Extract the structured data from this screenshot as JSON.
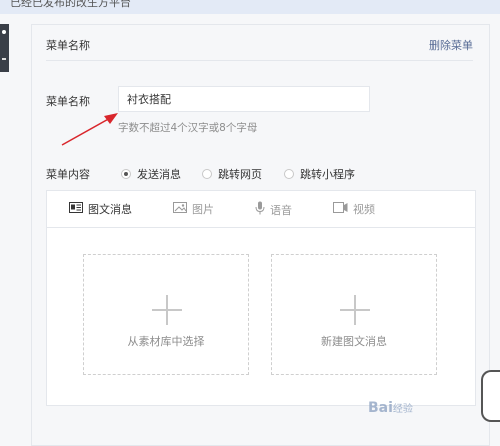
{
  "topbar": {
    "partial_text": "已经已发布的改生方平台"
  },
  "menu": {
    "header_title": "菜单名称",
    "delete_label": "删除菜单",
    "name_label": "菜单名称",
    "name_value": "衬衣搭配",
    "name_hint": "字数不超过4个汉字或8个字母",
    "content_label": "菜单内容",
    "options": [
      {
        "label": "发送消息",
        "checked": true
      },
      {
        "label": "跳转网页",
        "checked": false
      },
      {
        "label": "跳转小程序",
        "checked": false
      }
    ]
  },
  "editor": {
    "tabs": [
      {
        "label": "图文消息",
        "icon": "news-icon",
        "active": true
      },
      {
        "label": "图片",
        "icon": "image-icon",
        "active": false
      },
      {
        "label": "语音",
        "icon": "microphone-icon",
        "active": false
      },
      {
        "label": "视频",
        "icon": "video-icon",
        "active": false
      }
    ],
    "cards": [
      {
        "label": "从素材库中选择",
        "icon": "plus-icon"
      },
      {
        "label": "新建图文消息",
        "icon": "plus-icon"
      }
    ]
  },
  "watermark": {
    "text": "Bai",
    "sub": "经验"
  },
  "colors": {
    "link": "#576b95",
    "annotation_arrow": "#d9262c"
  }
}
